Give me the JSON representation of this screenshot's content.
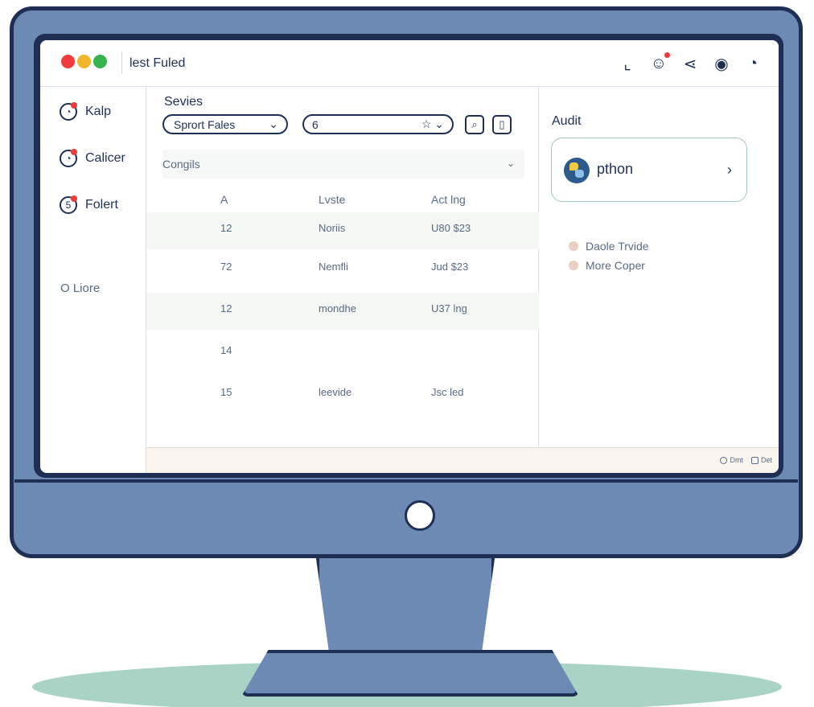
{
  "window": {
    "title": "lest Fuled"
  },
  "top_icons": [
    {
      "name": "bookmark-icon",
      "glyph": "⌞"
    },
    {
      "name": "emoji-icon",
      "glyph": "☺"
    },
    {
      "name": "share-icon",
      "glyph": "⋖"
    },
    {
      "name": "user-icon",
      "glyph": "◉"
    },
    {
      "name": "clock-icon",
      "glyph": "◔"
    }
  ],
  "sidebar": {
    "items": [
      {
        "label": "Kalp"
      },
      {
        "label": "Calicer"
      },
      {
        "label": "Folert"
      },
      {
        "label": "O Liore"
      }
    ]
  },
  "main": {
    "services_label": "Sevies",
    "select_value": "Sprort Fales",
    "number_value": "6",
    "subhead": "Congils",
    "table": {
      "columns": [
        "A",
        "Lvste",
        "Act lng"
      ],
      "rows": [
        [
          "12",
          "Noriis",
          "U80 $23"
        ],
        [
          "72",
          "Nemfli",
          "Jud $23"
        ],
        [
          "12",
          "mondhe",
          "U37 lng"
        ],
        [
          "14",
          "",
          ""
        ],
        [
          "15",
          "leevide",
          "Jsc led"
        ]
      ]
    }
  },
  "right_panel": {
    "audit_label": "Audit",
    "card_label": "pthon",
    "legend": [
      {
        "label": "Daole Trvide"
      },
      {
        "label": "More Coper"
      }
    ]
  },
  "status_bar": {
    "items": [
      {
        "label": "Dmt"
      },
      {
        "label": "Det"
      }
    ]
  },
  "colors": {
    "frame_navy": "#1f2f54",
    "frame_blue": "#6d8ab4",
    "table_shade": "#f4f7f3",
    "card_border": "#9fc8bf",
    "status_bg": "#fbf4ee"
  }
}
